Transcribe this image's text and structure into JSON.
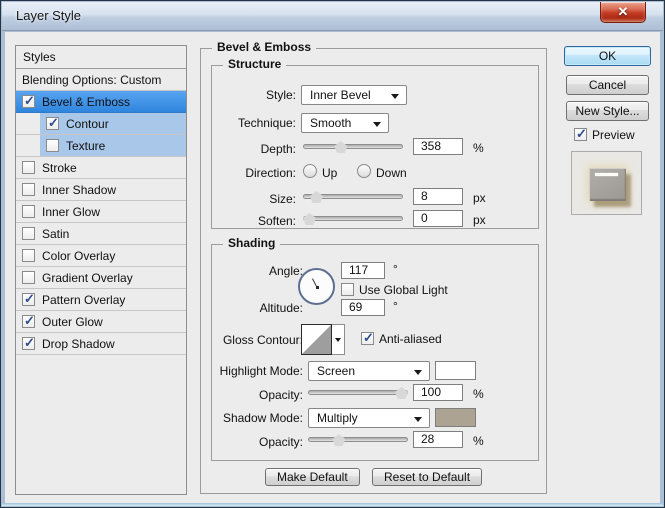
{
  "window": {
    "title": "Layer Style"
  },
  "sidebar": {
    "header": "Styles",
    "items": [
      {
        "label": "Blending Options: Custom"
      },
      {
        "label": "Bevel & Emboss"
      },
      {
        "label": "Contour"
      },
      {
        "label": "Texture"
      },
      {
        "label": "Stroke"
      },
      {
        "label": "Inner Shadow"
      },
      {
        "label": "Inner Glow"
      },
      {
        "label": "Satin"
      },
      {
        "label": "Color Overlay"
      },
      {
        "label": "Gradient Overlay"
      },
      {
        "label": "Pattern Overlay"
      },
      {
        "label": "Outer Glow"
      },
      {
        "label": "Drop Shadow"
      }
    ]
  },
  "main": {
    "title": "Bevel & Emboss",
    "structure": {
      "title": "Structure",
      "style_label": "Style:",
      "style_value": "Inner Bevel",
      "technique_label": "Technique:",
      "technique_value": "Smooth",
      "depth_label": "Depth:",
      "depth_value": "358",
      "depth_unit": "%",
      "depth_pct": 36,
      "direction_label": "Direction:",
      "up_label": "Up",
      "down_label": "Down",
      "size_label": "Size:",
      "size_value": "8",
      "size_unit": "px",
      "size_pct": 8,
      "soften_label": "Soften:",
      "soften_value": "0",
      "soften_unit": "px",
      "soften_pct": 0
    },
    "shading": {
      "title": "Shading",
      "angle_label": "Angle:",
      "angle_value": "117",
      "angle_unit": "°",
      "use_global_light_label": "Use Global Light",
      "altitude_label": "Altitude:",
      "altitude_value": "69",
      "altitude_unit": "°",
      "gloss_contour_label": "Gloss Contour:",
      "anti_aliased_label": "Anti-aliased",
      "highlight_mode_label": "Highlight Mode:",
      "highlight_mode_value": "Screen",
      "highlight_color": "#ffffff",
      "highlight_opacity_label": "Opacity:",
      "highlight_opacity_value": "100",
      "highlight_opacity_unit": "%",
      "highlight_opacity_pct": 100,
      "shadow_mode_label": "Shadow Mode:",
      "shadow_mode_value": "Multiply",
      "shadow_color": "#ada393",
      "shadow_opacity_label": "Opacity:",
      "shadow_opacity_value": "28",
      "shadow_opacity_unit": "%",
      "shadow_opacity_pct": 28
    },
    "footer": {
      "make_default": "Make Default",
      "reset_to_default": "Reset to Default"
    }
  },
  "actions": {
    "ok": "OK",
    "cancel": "Cancel",
    "new_style": "New Style...",
    "preview": "Preview"
  }
}
